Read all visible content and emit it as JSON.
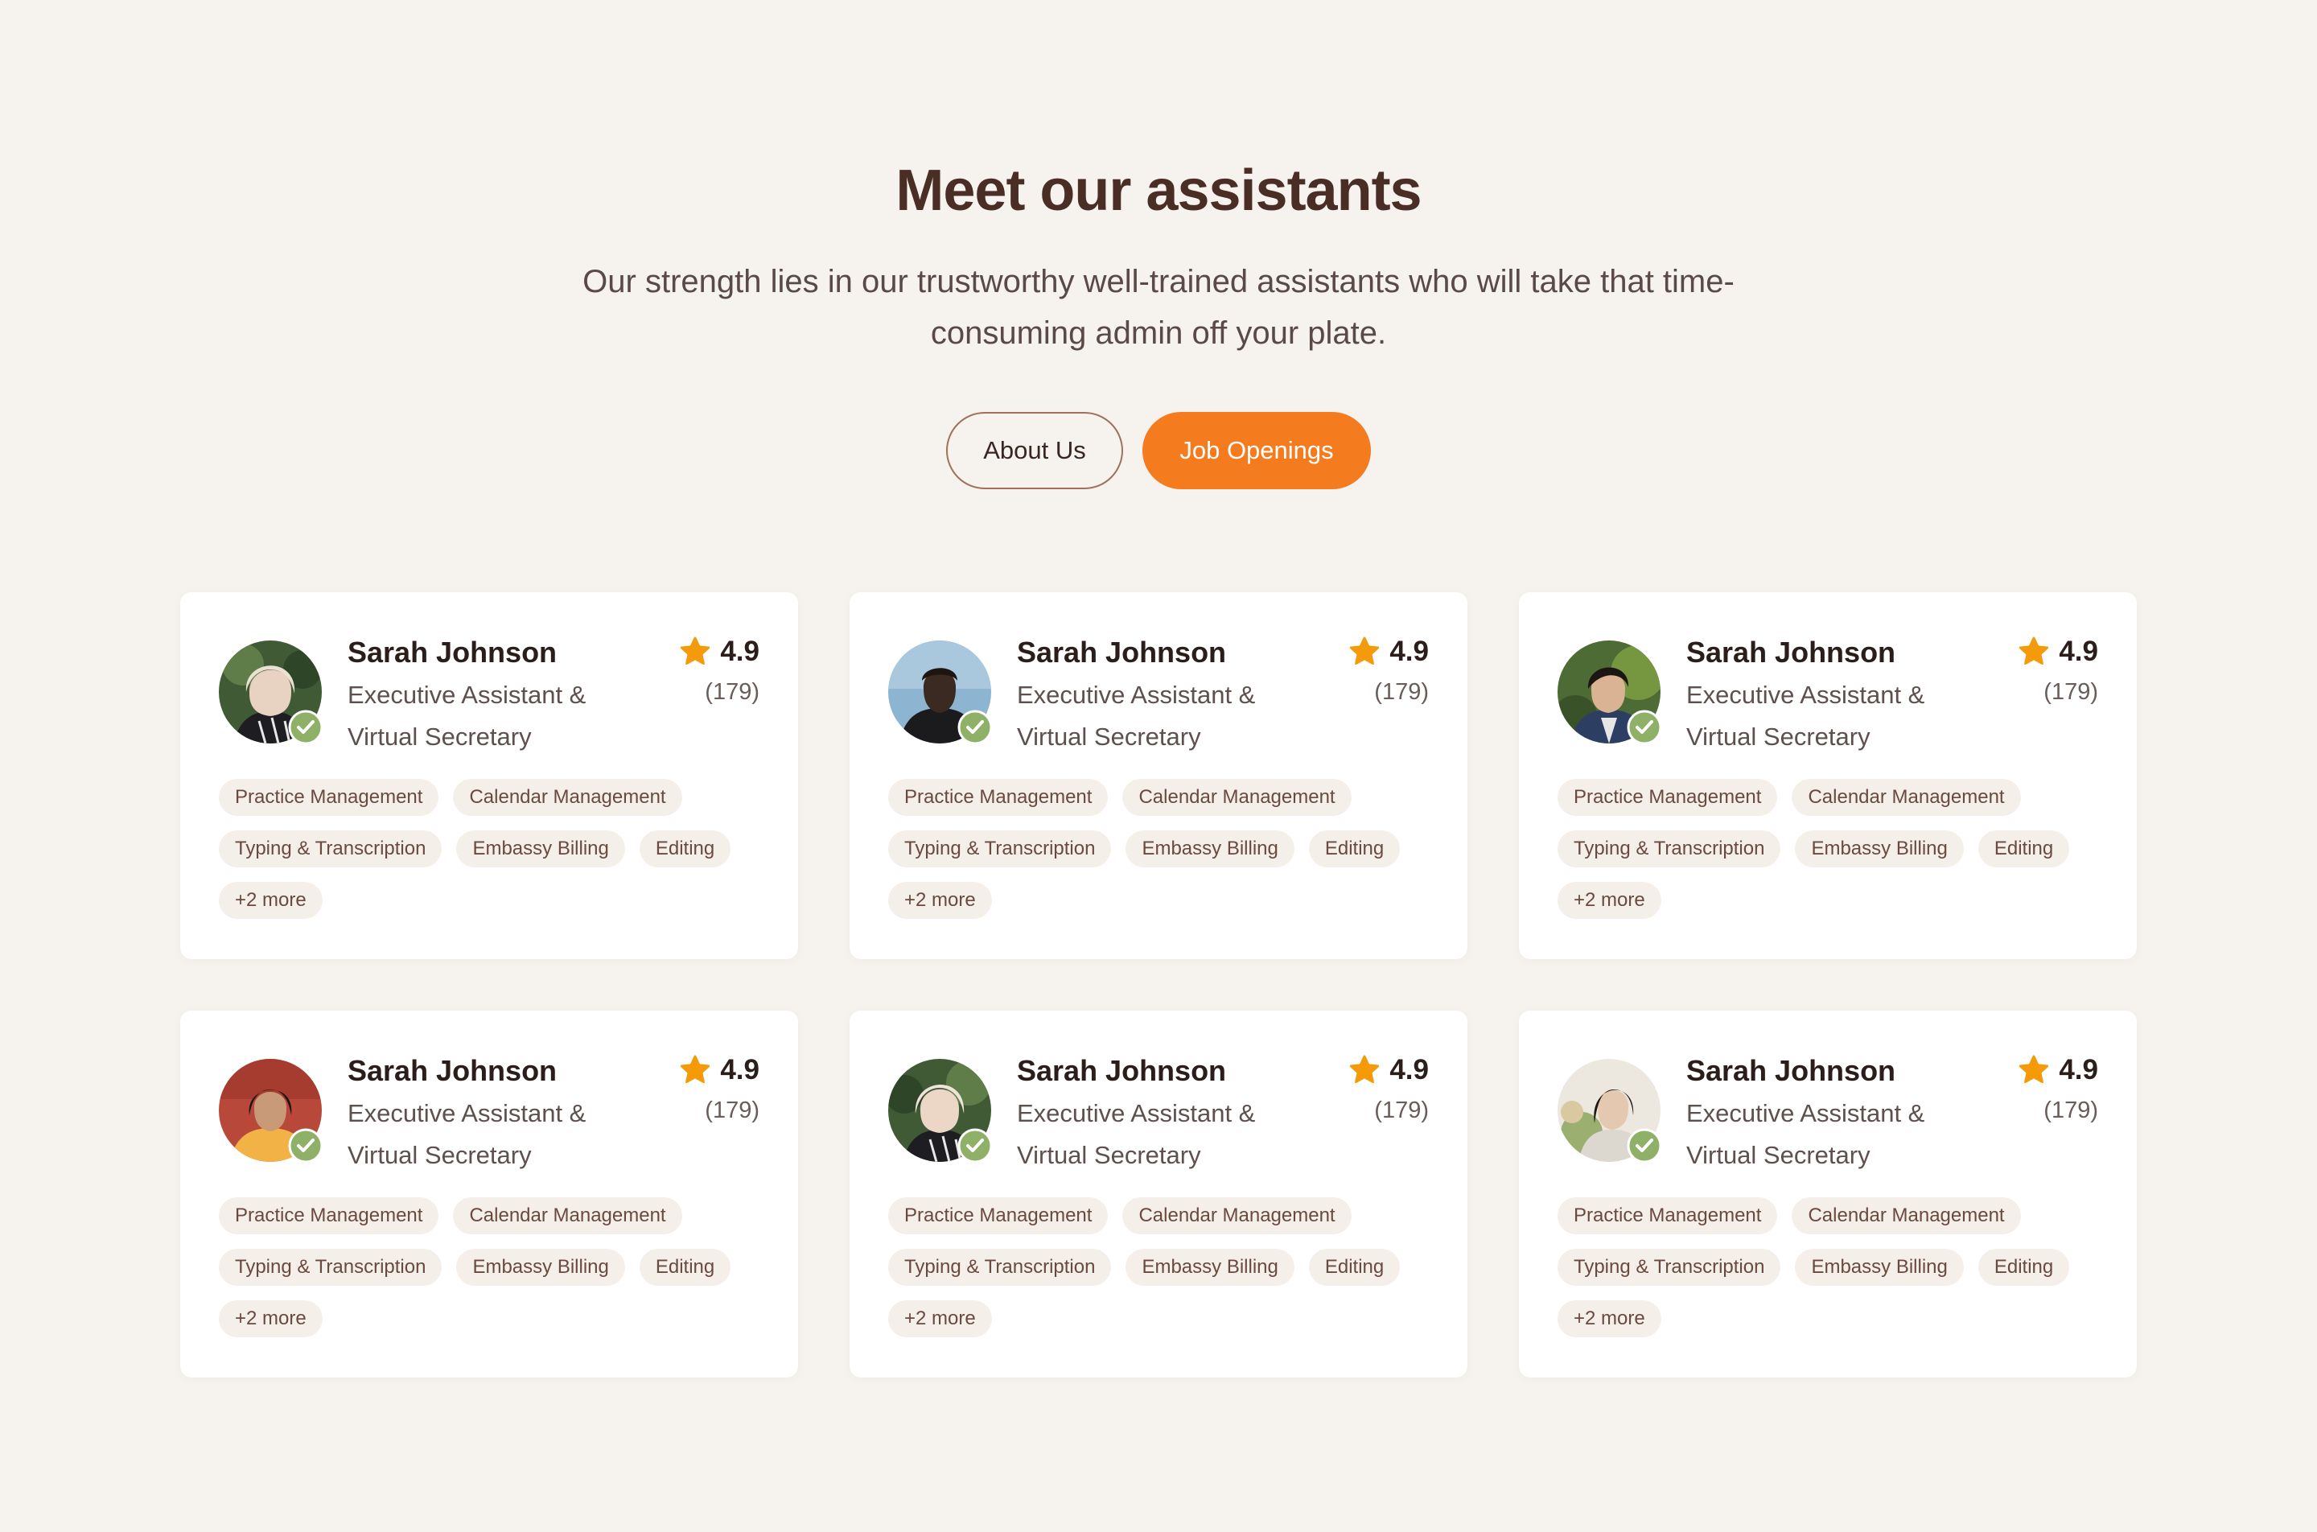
{
  "header": {
    "title": "Meet our assistants",
    "subtitle": "Our strength lies in our trustworthy well-trained assistants who will take that time-consuming admin off your plate.",
    "about_label": "About Us",
    "jobs_label": "Job Openings"
  },
  "colors": {
    "background": "#f6f3ef",
    "title": "#4a2e26",
    "accent": "#f57b1f",
    "star": "#f59b0b",
    "verified": "#8fb067",
    "tag_bg": "#f5efe9"
  },
  "icons": {
    "rating": "star-icon",
    "verified": "verified-check-icon"
  },
  "assistants": [
    {
      "name": "Sarah Johnson",
      "role": "Executive Assistant & Virtual Secretary",
      "rating": "4.9",
      "reviews": "(179)",
      "tags": [
        "Practice Management",
        "Calendar Management",
        "Typing & Transcription",
        "Embassy Billing",
        "Editing",
        "+2 more"
      ]
    },
    {
      "name": "Sarah Johnson",
      "role": "Executive Assistant & Virtual Secretary",
      "rating": "4.9",
      "reviews": "(179)",
      "tags": [
        "Practice Management",
        "Calendar Management",
        "Typing & Transcription",
        "Embassy Billing",
        "Editing",
        "+2 more"
      ]
    },
    {
      "name": "Sarah Johnson",
      "role": "Executive Assistant & Virtual Secretary",
      "rating": "4.9",
      "reviews": "(179)",
      "tags": [
        "Practice Management",
        "Calendar Management",
        "Typing & Transcription",
        "Embassy Billing",
        "Editing",
        "+2 more"
      ]
    },
    {
      "name": "Sarah Johnson",
      "role": "Executive Assistant & Virtual Secretary",
      "rating": "4.9",
      "reviews": "(179)",
      "tags": [
        "Practice Management",
        "Calendar Management",
        "Typing & Transcription",
        "Embassy Billing",
        "Editing",
        "+2 more"
      ]
    },
    {
      "name": "Sarah Johnson",
      "role": "Executive Assistant & Virtual Secretary",
      "rating": "4.9",
      "reviews": "(179)",
      "tags": [
        "Practice Management",
        "Calendar Management",
        "Typing & Transcription",
        "Embassy Billing",
        "Editing",
        "+2 more"
      ]
    },
    {
      "name": "Sarah Johnson",
      "role": "Executive Assistant & Virtual Secretary",
      "rating": "4.9",
      "reviews": "(179)",
      "tags": [
        "Practice Management",
        "Calendar Management",
        "Typing & Transcription",
        "Embassy Billing",
        "Editing",
        "+2 more"
      ]
    }
  ]
}
